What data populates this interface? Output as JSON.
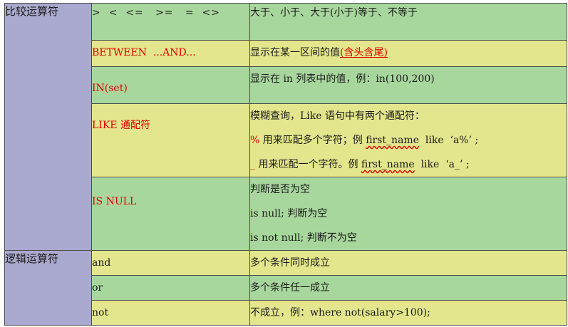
{
  "categories": {
    "comparison": "比较运算符",
    "logical": "逻辑运算符"
  },
  "rows": {
    "compare": {
      "op": ">  <  <=   >=   =  <>",
      "desc": "大于、小于、大于(小于)等于、不等于"
    },
    "between": {
      "op": "BETWEEN  ...AND...",
      "desc_prefix": "显示在某一区间的值",
      "desc_red": "(含头含尾)"
    },
    "in": {
      "op": "IN(set)",
      "desc": "显示在 in 列表中的值，例：in(100,200)"
    },
    "like": {
      "op": "LIKE 通配符",
      "desc_title": "模糊查询，Like 语句中有两个通配符：",
      "percent": {
        "symbol": "%",
        "text": " 用来匹配多个字符；例 ",
        "field": "first_name",
        "suffix": "  like  ‘a%’ ;"
      },
      "underscore": {
        "symbol": "_",
        "text": " 用来匹配一个字符。例 ",
        "field": "first_name",
        "suffix": "  like  ‘a_’ ;"
      }
    },
    "isnull": {
      "op": "IS NULL",
      "desc_lines": [
        "判断是否为空",
        "is null; 判断为空",
        "is not null; 判断不为空"
      ]
    },
    "and": {
      "op": "and",
      "desc": "多个条件同时成立"
    },
    "or": {
      "op": "or",
      "desc": "多个条件任一成立"
    },
    "not": {
      "op": "not",
      "desc": "不成立，例：where not(salary>100);"
    }
  },
  "colors": {
    "category_bg": "#aaa9cf",
    "green_bg": "#a8d79d",
    "yellow_bg": "#e3e68c",
    "red_text": "#e00000"
  }
}
